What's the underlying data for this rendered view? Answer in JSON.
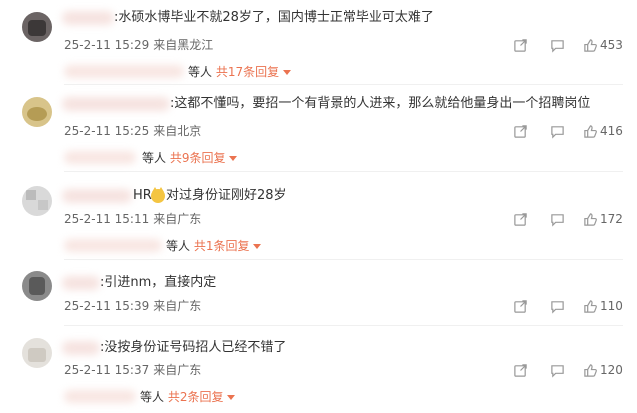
{
  "comments": [
    {
      "text": ":水硕水博毕业不就28岁了，国内博士正常毕业可太难了",
      "date": "25-2-11 15:29",
      "location": "来自黑龙江",
      "likes": "453",
      "reply_who": "等人",
      "reply_more": "共17条回复",
      "has_reply": true
    },
    {
      "text": ":这都不懂吗，要招一个有背景的人进来，那么就给他量身出一个招聘岗位",
      "date": "25-2-11 15:25",
      "location": "来自北京",
      "likes": "416",
      "reply_who": "等人",
      "reply_more": "共9条回复",
      "has_reply": true
    },
    {
      "text": "HR",
      "text2": "对过身份证刚好28岁",
      "emoji": "cat-face",
      "date": "25-2-11 15:11",
      "location": "来自广东",
      "likes": "172",
      "reply_who": "等人",
      "reply_more": "共1条回复",
      "has_reply": true
    },
    {
      "text": ":引进nm，直接内定",
      "date": "25-2-11 15:39",
      "location": "来自广东",
      "likes": "110",
      "has_reply": false
    },
    {
      "text": ":没按身份证号码招人已经不错了",
      "date": "25-2-11 15:37",
      "location": "来自广东",
      "likes": "120",
      "reply_who": "等人",
      "reply_more": "共2条回复",
      "has_reply": true
    }
  ],
  "icons": {
    "share": "share-icon",
    "comment": "comment-icon",
    "like": "like-icon"
  },
  "colors": {
    "accent": "#eb7350",
    "meta": "#666666",
    "text": "#333333"
  }
}
